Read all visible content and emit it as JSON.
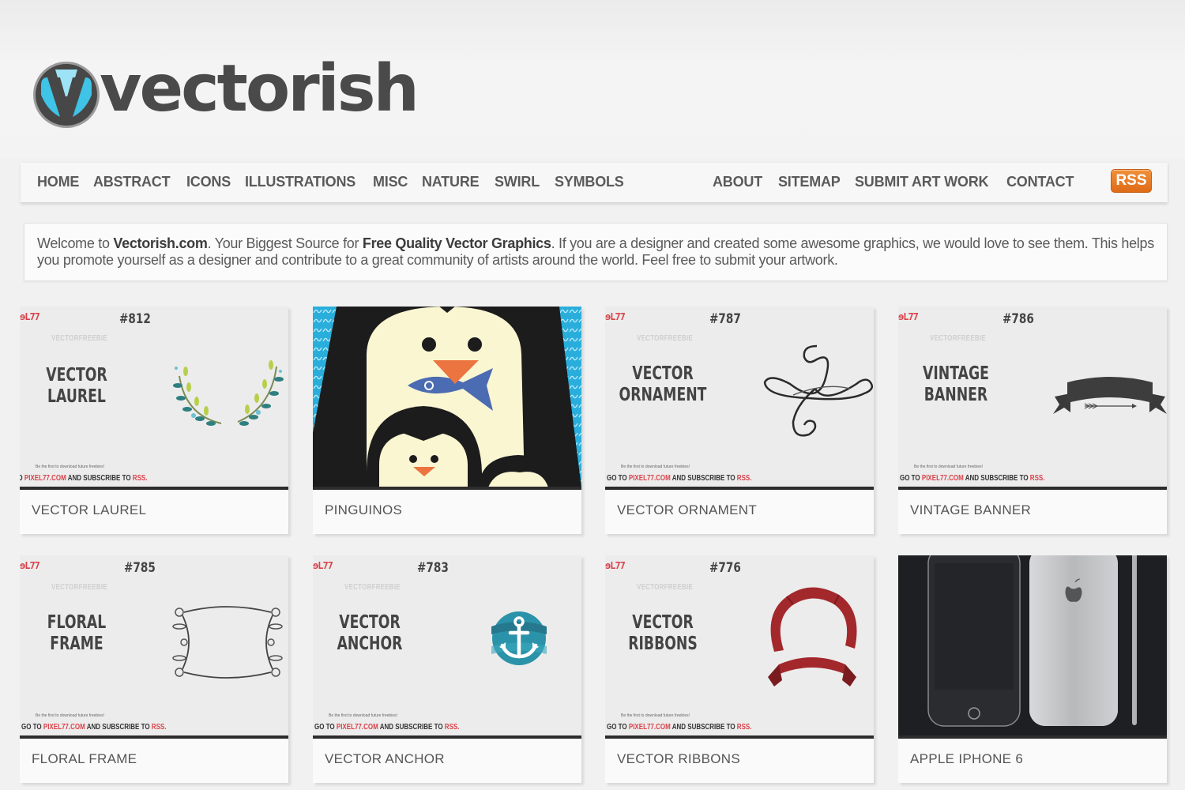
{
  "brand": {
    "name": "vectorish",
    "logo_letter": "V"
  },
  "nav": {
    "left": [
      "HOME",
      "ABSTRACT",
      "ICONS",
      "ILLUSTRATIONS",
      "MISC",
      "NATURE",
      "SWIRL",
      "SYMBOLS"
    ],
    "right": [
      "ABOUT",
      "SITEMAP",
      "SUBMIT ART WORK",
      "CONTACT"
    ],
    "rss_label": "RSS"
  },
  "welcome": {
    "p1": "Welcome to ",
    "b1": "Vectorish.com",
    "p2": ". Your Biggest Source for ",
    "b2": "Free Quality Vector Graphics",
    "p3": ". If you are a designer and created some awesome graphics, we would love to see them. This helps you promote yourself as a designer and contribute to a great community of artists around the world. Feel free to submit your artwork."
  },
  "thumb_common": {
    "pixel_logo_a": "ɘL",
    "pixel_logo_b": "77",
    "freebie": "VECTORFREEBIE",
    "small": "Be the first to download future freebies!",
    "foot_a": "GO TO ",
    "foot_site": "PIXEL77.COM",
    "foot_b": " AND SUBSCRIBE TO ",
    "foot_rss": "RSS."
  },
  "cards": [
    {
      "title": "VECTOR LAUREL",
      "num": "#812",
      "thumb_line1": "VECTOR",
      "thumb_line2": "LAUREL"
    },
    {
      "title": "PINGUINOS"
    },
    {
      "title": "VECTOR ORNAMENT",
      "num": "#787",
      "thumb_line1": "VECTOR",
      "thumb_line2": "ORNAMENT"
    },
    {
      "title": "VINTAGE BANNER",
      "num": "#786",
      "thumb_line1": "VINTAGE",
      "thumb_line2": "BANNER"
    },
    {
      "title": "FLORAL FRAME",
      "num": "#785",
      "thumb_line1": "FLORAL",
      "thumb_line2": "FRAME"
    },
    {
      "title": "VECTOR ANCHOR",
      "num": "#783",
      "thumb_line1": "VECTOR",
      "thumb_line2": "ANCHOR"
    },
    {
      "title": "VECTOR RIBBONS",
      "num": "#776",
      "thumb_line1": "VECTOR",
      "thumb_line2": "RIBBONS"
    },
    {
      "title": "APPLE IPHONE 6"
    }
  ],
  "colors": {
    "accent_rss": "#e4771f",
    "text": "#5a5a5a",
    "pixel_red": "#d9434b"
  }
}
